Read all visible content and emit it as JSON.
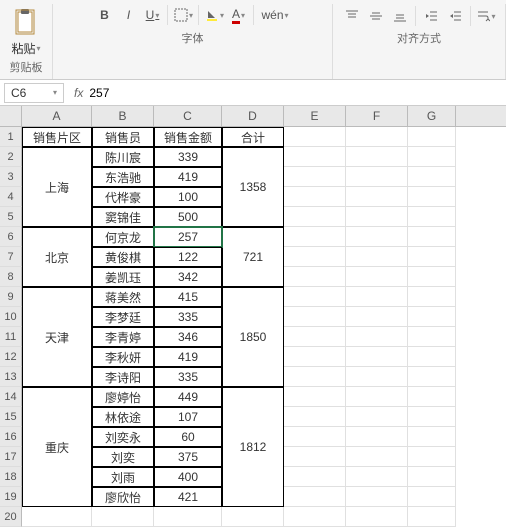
{
  "ribbon": {
    "clipboard": {
      "paste_title": "粘贴",
      "label": "剪贴板"
    },
    "font": {
      "bold": "B",
      "italic": "I",
      "underline": "U",
      "wen": "wén",
      "label": "字体"
    },
    "align": {
      "label": "对齐方式"
    }
  },
  "namebox": {
    "ref": "C6"
  },
  "formula": {
    "fx": "fx",
    "value": "257"
  },
  "columns": [
    "A",
    "B",
    "C",
    "D",
    "E",
    "F",
    "G"
  ],
  "chart_data": {
    "type": "table",
    "headers": {
      "region": "销售片区",
      "salesperson": "销售员",
      "amount": "销售金额",
      "total": "合计"
    },
    "groups": [
      {
        "region": "上海",
        "total": 1358,
        "rows": [
          {
            "name": "陈川宸",
            "amount": 339
          },
          {
            "name": "东浩驰",
            "amount": 419
          },
          {
            "name": "代桦豪",
            "amount": 100
          },
          {
            "name": "窦锦佳",
            "amount": 500
          }
        ]
      },
      {
        "region": "北京",
        "total": 721,
        "rows": [
          {
            "name": "何京龙",
            "amount": 257
          },
          {
            "name": "黄俊棋",
            "amount": 122
          },
          {
            "name": "姜凯珏",
            "amount": 342
          }
        ]
      },
      {
        "region": "天津",
        "total": 1850,
        "rows": [
          {
            "name": "蒋美然",
            "amount": 415
          },
          {
            "name": "李梦廷",
            "amount": 335
          },
          {
            "name": "李青婷",
            "amount": 346
          },
          {
            "name": "李秋妍",
            "amount": 419
          },
          {
            "name": "李诗阳",
            "amount": 335
          }
        ]
      },
      {
        "region": "重庆",
        "total": 1812,
        "rows": [
          {
            "name": "廖婷怡",
            "amount": 449
          },
          {
            "name": "林依途",
            "amount": 107
          },
          {
            "name": "刘奕永",
            "amount": 60
          },
          {
            "name": "刘奕",
            "amount": 375
          },
          {
            "name": "刘雨",
            "amount": 400
          },
          {
            "name": "廖欣怡",
            "amount": 421
          }
        ]
      }
    ]
  }
}
